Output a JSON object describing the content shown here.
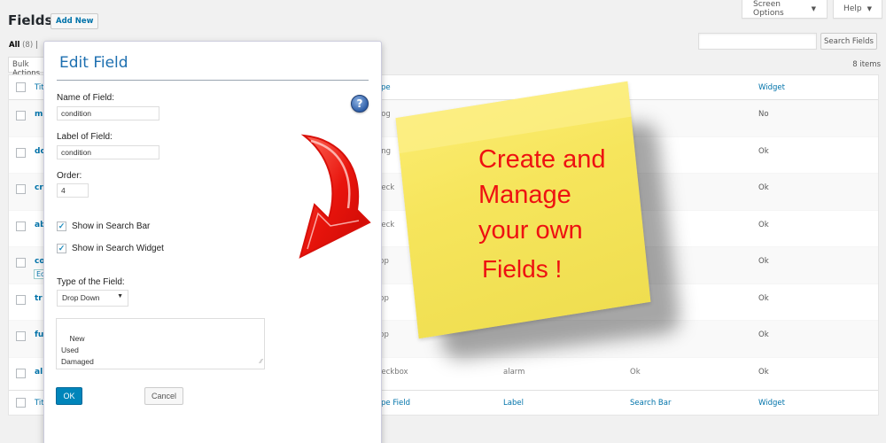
{
  "header": {
    "title": "Fields",
    "add_new": "Add New",
    "screen_options": "Screen Options",
    "help": "Help"
  },
  "filters": {
    "all_label": "All",
    "all_count": "(8)",
    "separator": "|"
  },
  "search": {
    "placeholder": "",
    "button": "Search Fields"
  },
  "items_count": "8 items",
  "bulk_actions": "Bulk Actions",
  "table": {
    "columns": [
      "Title",
      "Type Field",
      "Label",
      "Search Bar",
      "Widget"
    ],
    "header_visible": {
      "title": "Tit",
      "type": "ype",
      "widget": "Widget"
    },
    "footer_visible": {
      "title": "Tit",
      "type": "ype Field",
      "label": "Label",
      "search_bar": "Search Bar",
      "widget": "Widget"
    },
    "rows": [
      {
        "title": "m",
        "type": "oog",
        "label": "",
        "search_bar": "",
        "widget": "No"
      },
      {
        "title": "dc",
        "type": "ang",
        "label": "",
        "search_bar": "",
        "widget": "Ok"
      },
      {
        "title": "cr",
        "type": "heck",
        "label": "",
        "search_bar": "",
        "widget": "Ok"
      },
      {
        "title": "ab",
        "type": "heck",
        "label": "",
        "search_bar": "",
        "widget": "Ok"
      },
      {
        "title": "co",
        "type": "rop",
        "label": "",
        "search_bar": "",
        "widget": "Ok",
        "row_action": "Ed"
      },
      {
        "title": "tr",
        "type": "rop",
        "label": "",
        "search_bar": "",
        "widget": "Ok"
      },
      {
        "title": "fu",
        "type": "rop",
        "label": "",
        "search_bar": "",
        "widget": "Ok"
      },
      {
        "title": "al",
        "type": "heckbox",
        "label": "alarm",
        "search_bar": "Ok",
        "widget": "Ok"
      }
    ]
  },
  "modal": {
    "title": "Edit Field",
    "help_icon": "?",
    "name_label": "Name of Field:",
    "name_value": "condition",
    "label_label": "Label of Field:",
    "label_value": "condition",
    "order_label": "Order:",
    "order_value": "4",
    "show_search_bar": {
      "label": "Show in Search Bar",
      "checked": true
    },
    "show_search_widget": {
      "label": "Show in Search Widget",
      "checked": true
    },
    "type_label": "Type of the Field:",
    "type_value": "Drop Down",
    "options_text": "New\nUsed\nDamaged",
    "ok": "OK",
    "cancel": "Cancel"
  },
  "sticky_note": {
    "lines": [
      "Create and",
      "Manage",
      "your own",
      "Fields !"
    ],
    "text_color": "#ee1111",
    "note_color": "#f6e55c"
  },
  "colors": {
    "link": "#0073aa",
    "primary_button": "#0085ba",
    "modal_title": "#1d6fb0",
    "arrow": "#e8140c"
  }
}
